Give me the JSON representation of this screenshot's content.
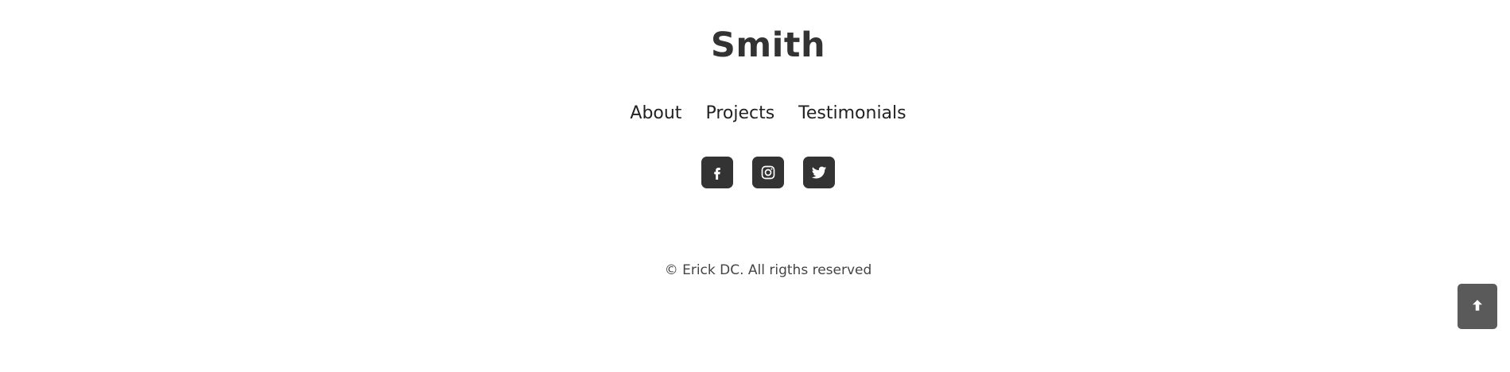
{
  "brand": {
    "name": "Smith"
  },
  "nav": {
    "items": [
      {
        "label": "About"
      },
      {
        "label": "Projects"
      },
      {
        "label": "Testimonials"
      }
    ]
  },
  "socials": [
    {
      "icon": "facebook-icon"
    },
    {
      "icon": "instagram-icon"
    },
    {
      "icon": "twitter-icon"
    }
  ],
  "copyright": {
    "text": "© Erick DC. All rigths reserved"
  },
  "scroll_top": {
    "icon": "arrow-up-icon"
  },
  "colors": {
    "text_dark": "#333333",
    "social_bg": "#333333",
    "scroll_top_bg": "#5a5a5a",
    "background": "#ffffff"
  }
}
